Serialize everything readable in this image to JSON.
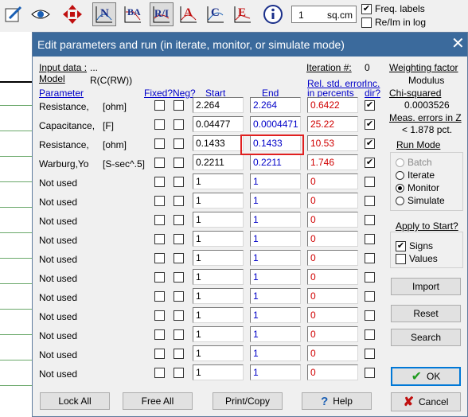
{
  "toolbar": {
    "area_value": "1",
    "area_unit": "sq.cm",
    "freq_labels": "Freq. labels",
    "relm_log": "Re/Im in log",
    "letters": [
      "N",
      "BA",
      "R/I",
      "A",
      "C",
      "E"
    ]
  },
  "dialog": {
    "title": "Edit parameters and run (in iterate, monitor, or simulate mode)",
    "input_data_label": "Input data :",
    "input_data_value": "...",
    "model_label": "Model",
    "model_value": "R(C(RW))",
    "iteration_label": "Iteration #:",
    "iteration_value": "0",
    "headers": {
      "parameter": "Parameter",
      "fixed": "Fixed?",
      "neg": "Neg?",
      "start": "Start",
      "end": "End",
      "rel_std_1": "Rel. std. error",
      "rel_std_2": "in percents",
      "inc_1": "Inc.",
      "inc_2": "dir?"
    },
    "rows": [
      {
        "name": "Resistance,",
        "unit": "[ohm]",
        "start": "2.264",
        "end": "2.264",
        "err": "0.6422",
        "inc": true
      },
      {
        "name": "Capacitance,",
        "unit": "[F]",
        "start": "0.04477",
        "end": "0.0004471",
        "err": "25.22",
        "inc": true
      },
      {
        "name": "Resistance,",
        "unit": "[ohm]",
        "start": "0.1433",
        "end": "0.1433",
        "err": "10.53",
        "inc": true
      },
      {
        "name": "Warburg,Yo",
        "unit": "[S-sec^.5]",
        "start": "0.2211",
        "end": "0.2211",
        "err": "1.746",
        "inc": true
      },
      {
        "name": "Not used",
        "unit": "",
        "start": "1",
        "end": "1",
        "err": "0",
        "inc": false
      },
      {
        "name": "Not used",
        "unit": "",
        "start": "1",
        "end": "1",
        "err": "0",
        "inc": false
      },
      {
        "name": "Not used",
        "unit": "",
        "start": "1",
        "end": "1",
        "err": "0",
        "inc": false
      },
      {
        "name": "Not used",
        "unit": "",
        "start": "1",
        "end": "1",
        "err": "0",
        "inc": false
      },
      {
        "name": "Not used",
        "unit": "",
        "start": "1",
        "end": "1",
        "err": "0",
        "inc": false
      },
      {
        "name": "Not used",
        "unit": "",
        "start": "1",
        "end": "1",
        "err": "0",
        "inc": false
      },
      {
        "name": "Not used",
        "unit": "",
        "start": "1",
        "end": "1",
        "err": "0",
        "inc": false
      },
      {
        "name": "Not used",
        "unit": "",
        "start": "1",
        "end": "1",
        "err": "0",
        "inc": false
      },
      {
        "name": "Not used",
        "unit": "",
        "start": "1",
        "end": "1",
        "err": "0",
        "inc": false
      },
      {
        "name": "Not used",
        "unit": "",
        "start": "1",
        "end": "1",
        "err": "0",
        "inc": false
      },
      {
        "name": "Not used",
        "unit": "",
        "start": "1",
        "end": "1",
        "err": "0",
        "inc": false
      }
    ],
    "right": {
      "weighting_label": "Weighting factor",
      "weighting_value": "Modulus",
      "chi_label": "Chi-squared",
      "chi_value": "0.0003526",
      "meas_label": "Meas. errors in Z",
      "meas_value": "< 1.878 pct.",
      "run_mode_label": "Run Mode",
      "modes": [
        "Batch",
        "Iterate",
        "Monitor",
        "Simulate"
      ],
      "selected_mode": "Monitor",
      "apply_label": "Apply to Start?",
      "apply_signs": "Signs",
      "apply_values": "Values",
      "import": "Import",
      "reset": "Reset",
      "search": "Search",
      "ok": "OK",
      "cancel": "Cancel"
    },
    "bottom": {
      "lock_all": "Lock All",
      "free_all": "Free All",
      "print_copy": "Print/Copy",
      "help": "Help"
    },
    "colors": {
      "titlebar": "#3b6a9c",
      "link_blue": "#0000c8",
      "error_red": "#d00000",
      "highlight": "#e02020"
    }
  }
}
